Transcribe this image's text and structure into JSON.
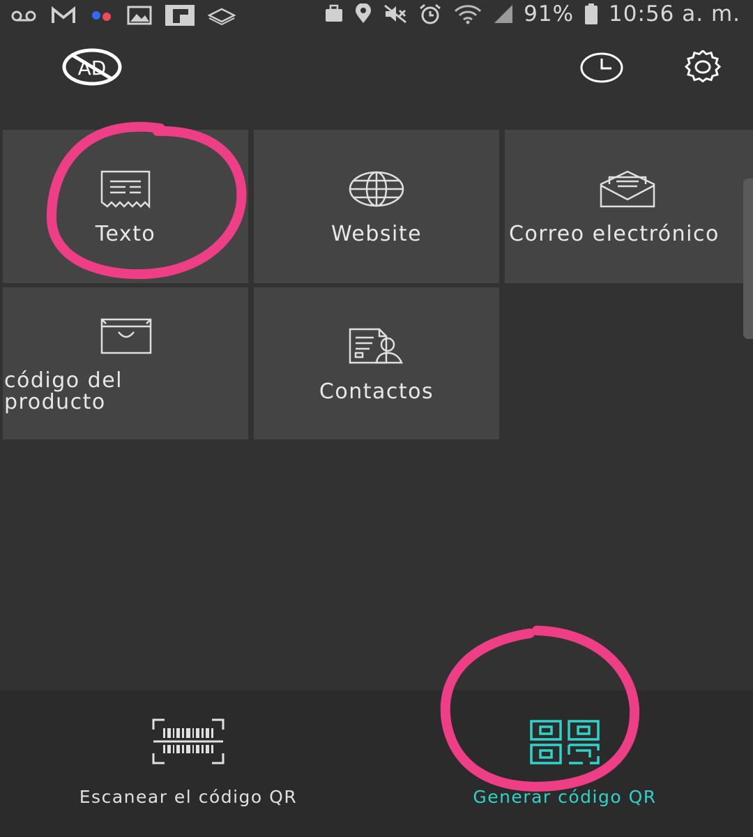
{
  "status_bar": {
    "battery": "91%",
    "time": "10:56 a. m.",
    "icons": [
      "voicemail-icon",
      "gmail-icon",
      "app-dots-icon",
      "image-icon",
      "flipboard-icon",
      "layers-icon",
      "briefcase-icon",
      "location-icon",
      "mute-icon",
      "alarm-icon",
      "wifi-icon",
      "signal-icon",
      "battery-icon"
    ]
  },
  "top_bar": {
    "ad_icon_text": "AD",
    "icons": [
      "no-ads-icon",
      "history-icon",
      "settings-icon"
    ]
  },
  "tiles": [
    {
      "label": "Texto",
      "icon": "text-document-icon"
    },
    {
      "label": "Website",
      "icon": "globe-icon"
    },
    {
      "label": "Correo electrónico",
      "icon": "envelope-icon"
    },
    {
      "label_lines": [
        "código del",
        "producto"
      ],
      "icon": "shopping-bag-icon"
    },
    {
      "label": "Contactos",
      "icon": "contact-card-icon"
    }
  ],
  "bottom_nav": {
    "scan_label": "Escanear el código QR",
    "generate_label": "Generar código QR",
    "active": "generate"
  },
  "colors": {
    "background": "#323232",
    "tile": "#444444",
    "accent": "#2fd3c9",
    "annotation": "#ee3f86"
  }
}
